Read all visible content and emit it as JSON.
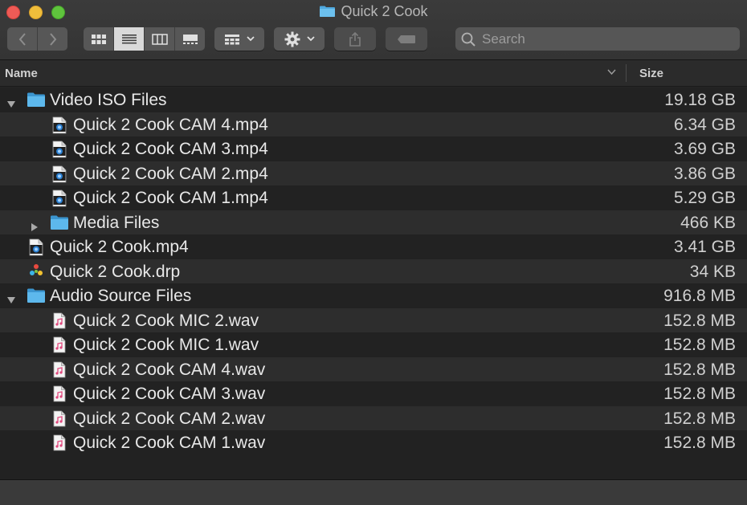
{
  "window": {
    "title": "Quick 2 Cook"
  },
  "toolbar": {
    "search_placeholder": "Search"
  },
  "columns": {
    "name": "Name",
    "size": "Size"
  },
  "rows": [
    {
      "name": "Video ISO Files",
      "size": "19.18 GB",
      "type": "folder",
      "level": 0,
      "disclosure": "expanded"
    },
    {
      "name": "Quick 2 Cook CAM 4.mp4",
      "size": "6.34 GB",
      "type": "video",
      "level": 1
    },
    {
      "name": "Quick 2 Cook CAM 3.mp4",
      "size": "3.69 GB",
      "type": "video",
      "level": 1
    },
    {
      "name": "Quick 2 Cook CAM 2.mp4",
      "size": "3.86 GB",
      "type": "video",
      "level": 1
    },
    {
      "name": "Quick 2 Cook CAM 1.mp4",
      "size": "5.29 GB",
      "type": "video",
      "level": 1
    },
    {
      "name": "Media Files",
      "size": "466 KB",
      "type": "folder",
      "level": 1,
      "disclosure": "collapsed"
    },
    {
      "name": "Quick 2 Cook.mp4",
      "size": "3.41 GB",
      "type": "video",
      "level": 0
    },
    {
      "name": "Quick 2 Cook.drp",
      "size": "34 KB",
      "type": "resolve",
      "level": 0
    },
    {
      "name": "Audio Source Files",
      "size": "916.8 MB",
      "type": "folder",
      "level": 0,
      "disclosure": "expanded"
    },
    {
      "name": "Quick 2 Cook MIC 2.wav",
      "size": "152.8 MB",
      "type": "audio",
      "level": 1
    },
    {
      "name": "Quick 2 Cook MIC 1.wav",
      "size": "152.8 MB",
      "type": "audio",
      "level": 1
    },
    {
      "name": "Quick 2 Cook CAM 4.wav",
      "size": "152.8 MB",
      "type": "audio",
      "level": 1
    },
    {
      "name": "Quick 2 Cook CAM 3.wav",
      "size": "152.8 MB",
      "type": "audio",
      "level": 1
    },
    {
      "name": "Quick 2 Cook CAM 2.wav",
      "size": "152.8 MB",
      "type": "audio",
      "level": 1
    },
    {
      "name": "Quick 2 Cook CAM 1.wav",
      "size": "152.8 MB",
      "type": "audio",
      "level": 1
    }
  ],
  "colors": {
    "folder": "#4fa9e0",
    "close": "#ee5b56",
    "minimize": "#f0be3b",
    "zoom": "#5fc43d"
  }
}
